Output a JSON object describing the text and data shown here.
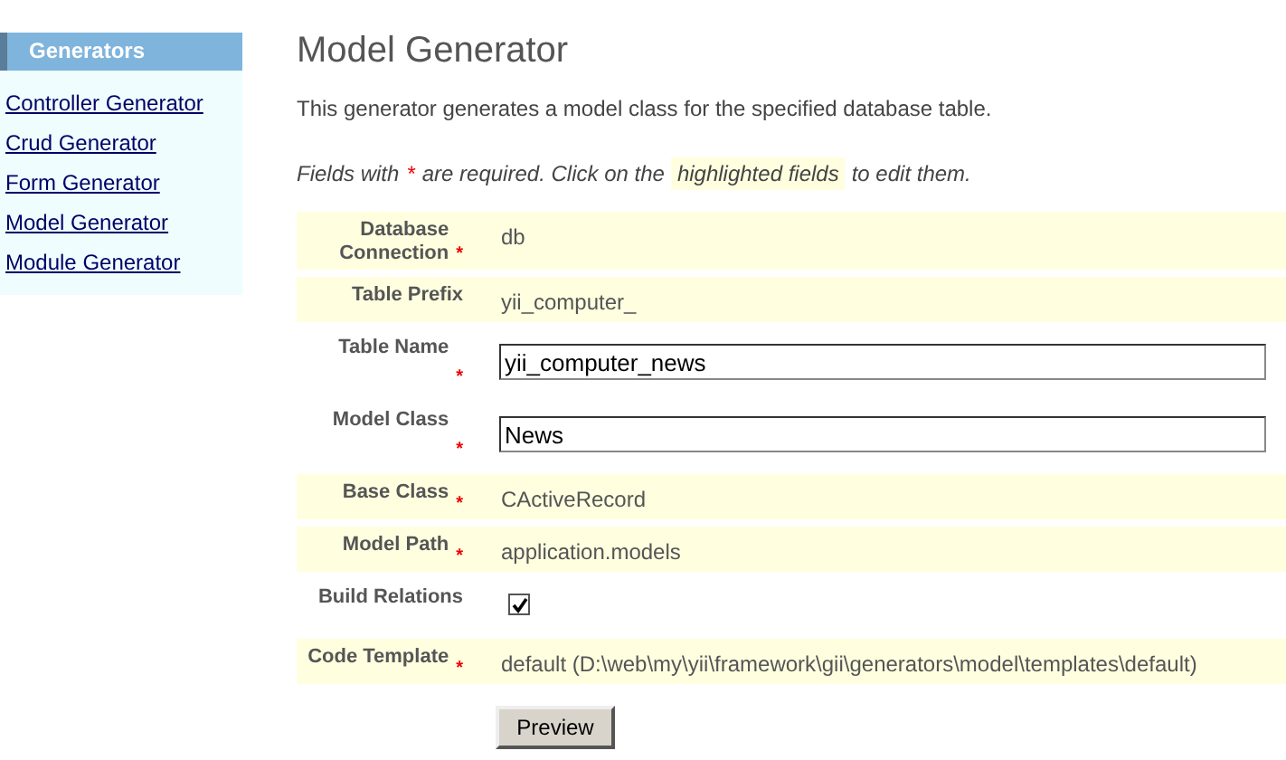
{
  "sidebar": {
    "title": "Generators",
    "items": [
      {
        "label": "Controller Generator"
      },
      {
        "label": "Crud Generator"
      },
      {
        "label": "Form Generator"
      },
      {
        "label": "Model Generator"
      },
      {
        "label": "Module Generator"
      }
    ]
  },
  "page": {
    "title": "Model Generator",
    "description": "This generator generates a model class for the specified database table.",
    "hint_before": "Fields with",
    "hint_star": "*",
    "hint_middle": "are required. Click on the",
    "hint_highlight": "highlighted fields",
    "hint_after": "to edit them."
  },
  "fields": [
    {
      "kind": "static",
      "label": "Database Connection",
      "required": true,
      "value": "db"
    },
    {
      "kind": "static",
      "label": "Table Prefix",
      "required": false,
      "value": "yii_computer_"
    },
    {
      "kind": "input",
      "label": "Table Name",
      "required": true,
      "value": "yii_computer_news"
    },
    {
      "kind": "input",
      "label": "Model Class",
      "required": true,
      "value": "News"
    },
    {
      "kind": "static",
      "label": "Base Class",
      "required": true,
      "value": "CActiveRecord"
    },
    {
      "kind": "static",
      "label": "Model Path",
      "required": true,
      "value": "application.models"
    },
    {
      "kind": "checkbox",
      "label": "Build Relations",
      "required": false,
      "checked": true
    },
    {
      "kind": "static",
      "label": "Code Template",
      "required": true,
      "value": "default  (D:\\web\\my\\yii\\framework\\gii\\generators\\model\\templates\\default)"
    }
  ],
  "button": "Preview"
}
